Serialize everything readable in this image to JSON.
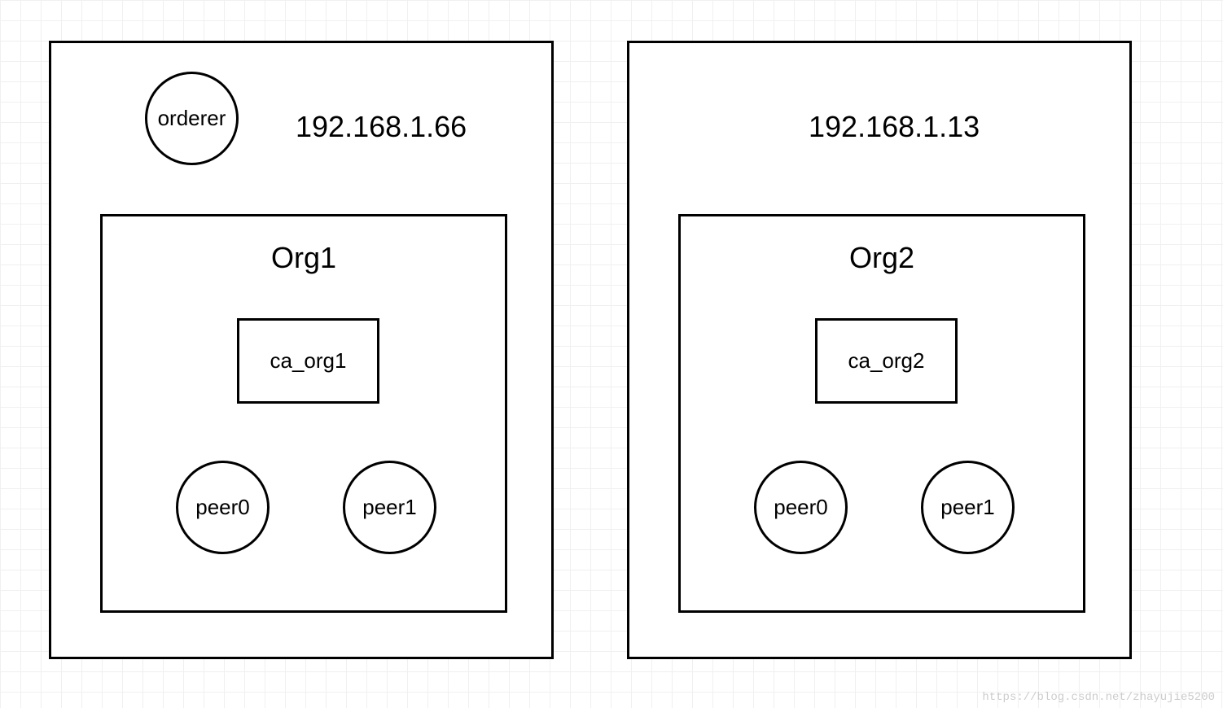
{
  "hosts": [
    {
      "ip": "192.168.1.66",
      "orderer": "orderer",
      "org": {
        "name": "Org1",
        "ca": "ca_org1",
        "peers": [
          "peer0",
          "peer1"
        ]
      }
    },
    {
      "ip": "192.168.1.13",
      "orderer": null,
      "org": {
        "name": "Org2",
        "ca": "ca_org2",
        "peers": [
          "peer0",
          "peer1"
        ]
      }
    }
  ],
  "watermark": "https://blog.csdn.net/zhayujie5200"
}
